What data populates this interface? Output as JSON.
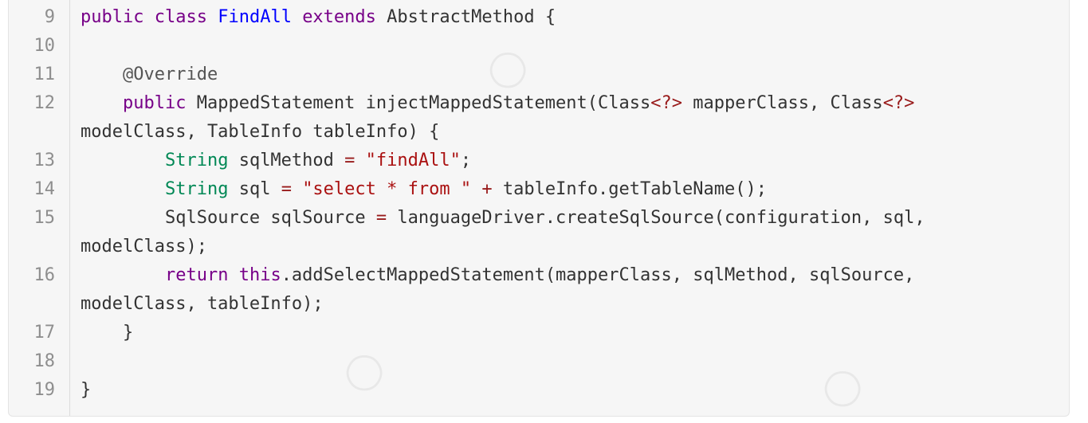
{
  "code": {
    "lines": [
      {
        "num": "9",
        "tokens": [
          {
            "t": "public",
            "c": "kw"
          },
          {
            "t": " "
          },
          {
            "t": "class",
            "c": "kw"
          },
          {
            "t": " "
          },
          {
            "t": "FindAll",
            "c": "def"
          },
          {
            "t": " "
          },
          {
            "t": "extends",
            "c": "kw"
          },
          {
            "t": " AbstractMethod {"
          }
        ]
      },
      {
        "num": "10",
        "tokens": [
          {
            "t": ""
          }
        ]
      },
      {
        "num": "11",
        "tokens": [
          {
            "t": "    "
          },
          {
            "t": "@Override",
            "c": "meta"
          }
        ]
      },
      {
        "num": "12",
        "tokens": [
          {
            "t": "    "
          },
          {
            "t": "public",
            "c": "kw"
          },
          {
            "t": " MappedStatement injectMappedStatement(Class"
          },
          {
            "t": "<?>",
            "c": "op"
          },
          {
            "t": " mapperClass, Class"
          },
          {
            "t": "<?>",
            "c": "op"
          },
          {
            "t": " modelClass, TableInfo tableInfo) {"
          }
        ]
      },
      {
        "num": "13",
        "tokens": [
          {
            "t": "        "
          },
          {
            "t": "String",
            "c": "ty"
          },
          {
            "t": " sqlMethod "
          },
          {
            "t": "=",
            "c": "op"
          },
          {
            "t": " "
          },
          {
            "t": "\"findAll\"",
            "c": "str"
          },
          {
            "t": ";"
          }
        ]
      },
      {
        "num": "14",
        "tokens": [
          {
            "t": "        "
          },
          {
            "t": "String",
            "c": "ty"
          },
          {
            "t": " sql "
          },
          {
            "t": "=",
            "c": "op"
          },
          {
            "t": " "
          },
          {
            "t": "\"select * from \"",
            "c": "str"
          },
          {
            "t": " "
          },
          {
            "t": "+",
            "c": "op"
          },
          {
            "t": " tableInfo.getTableName();"
          }
        ]
      },
      {
        "num": "15",
        "tokens": [
          {
            "t": "        SqlSource sqlSource "
          },
          {
            "t": "=",
            "c": "op"
          },
          {
            "t": " languageDriver.createSqlSource(configuration, sql, modelClass);"
          }
        ]
      },
      {
        "num": "16",
        "tokens": [
          {
            "t": "        "
          },
          {
            "t": "return",
            "c": "kw"
          },
          {
            "t": " "
          },
          {
            "t": "this",
            "c": "kw"
          },
          {
            "t": ".addSelectMappedStatement(mapperClass, sqlMethod, sqlSource, modelClass, tableInfo);"
          }
        ]
      },
      {
        "num": "17",
        "tokens": [
          {
            "t": "    }"
          }
        ]
      },
      {
        "num": "18",
        "tokens": [
          {
            "t": ""
          }
        ]
      },
      {
        "num": "19",
        "tokens": [
          {
            "t": "}"
          }
        ]
      }
    ]
  },
  "colors": {
    "background": "#f6f6f6",
    "keyword": "#770088",
    "definition": "#0000ff",
    "type": "#008855",
    "string": "#aa1111",
    "operator": "#981a1a",
    "line_number": "#8e8e8e"
  }
}
